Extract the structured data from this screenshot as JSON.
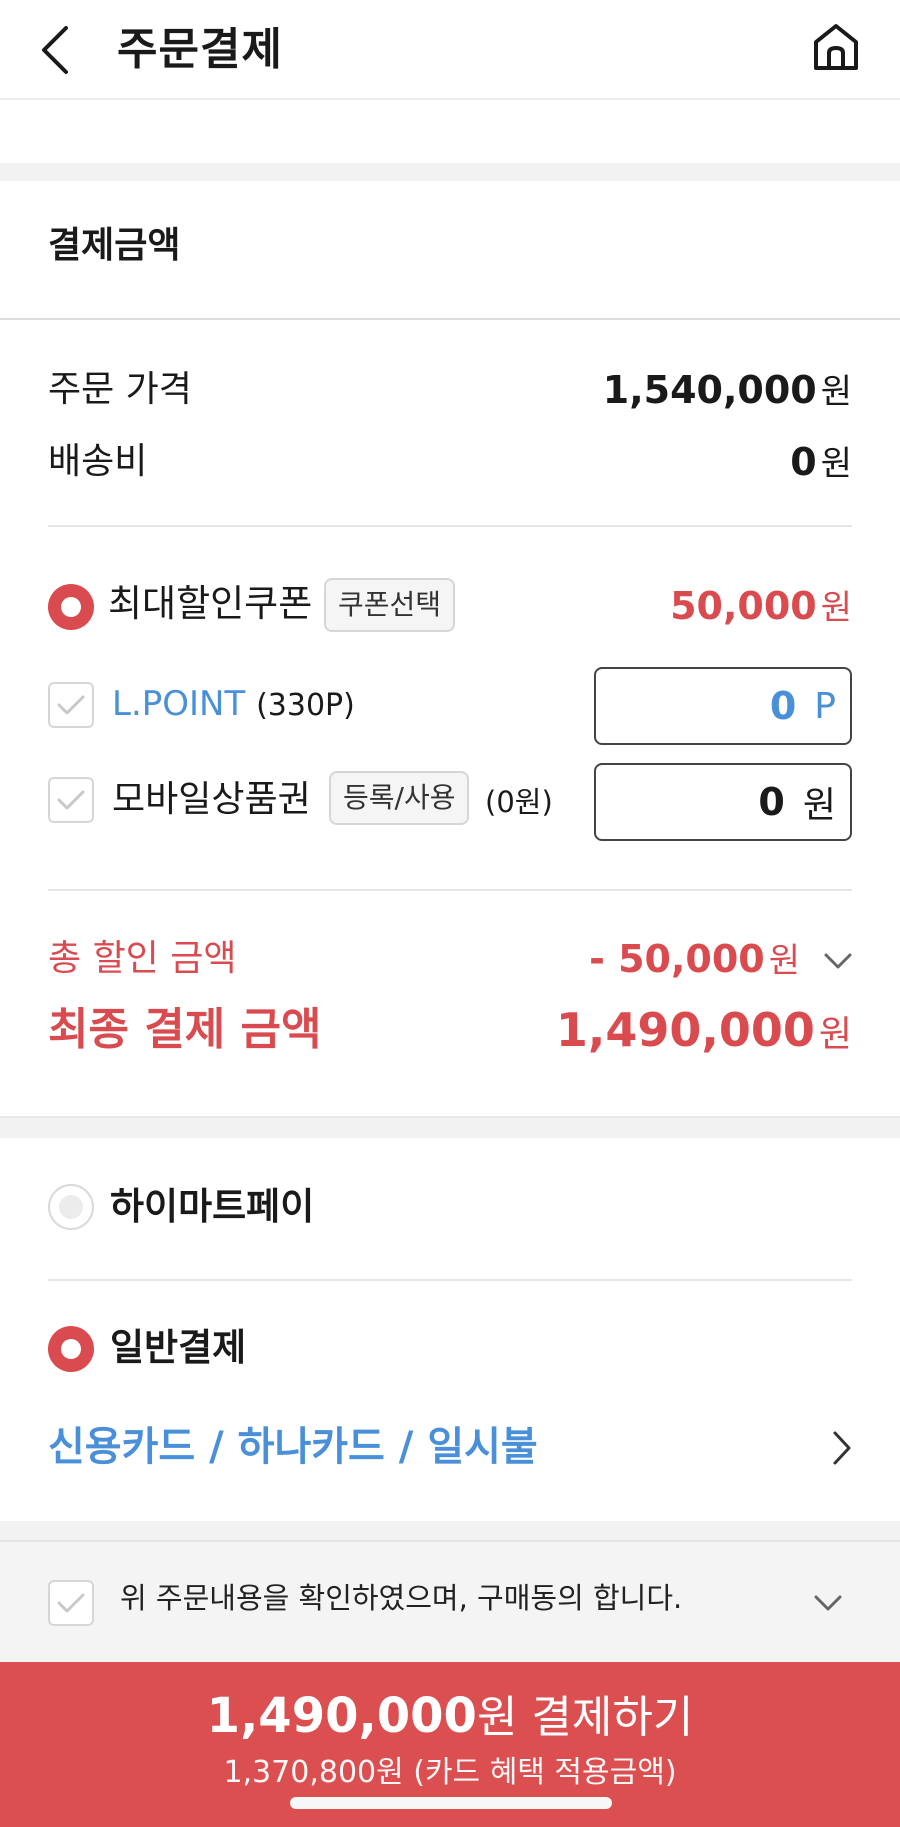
{
  "header": {
    "title": "주문결제"
  },
  "payment_amount": {
    "section_title": "결제금액",
    "order_price_label": "주문 가격",
    "order_price_value": "1,540,000",
    "shipping_label": "배송비",
    "shipping_value": "0",
    "currency_unit": "원"
  },
  "discounts": {
    "coupon_label": "최대할인쿠폰",
    "coupon_button": "쿠폰선택",
    "coupon_value": "50,000",
    "lpoint_label": "L.POINT",
    "lpoint_balance": "(330P)",
    "lpoint_input_value": "0",
    "lpoint_unit": "P",
    "giftcard_label": "모바일상품권",
    "giftcard_button": "등록/사용",
    "giftcard_balance": "(0원)",
    "giftcard_input_value": "0",
    "giftcard_unit": "원"
  },
  "totals": {
    "total_discount_label": "총 할인 금액",
    "total_discount_value": "- 50,000",
    "final_label": "최종 결제 금액",
    "final_value": "1,490,000"
  },
  "payment_methods": {
    "himart_pay_label": "하이마트페이",
    "general_label": "일반결제",
    "card_selection": "신용카드 / 하나카드 / 일시불"
  },
  "agreement": {
    "text": "위 주문내용을 확인하였으며, 구매동의 합니다."
  },
  "pay_button": {
    "amount": "1,490,000",
    "label_suffix": "원 결제하기",
    "sub_text": "1,370,800원 (카드 혜택 적용금액)"
  },
  "colors": {
    "accent_red": "#d94b4f",
    "link_blue": "#4a90d9",
    "button_red": "#dc4f51"
  }
}
